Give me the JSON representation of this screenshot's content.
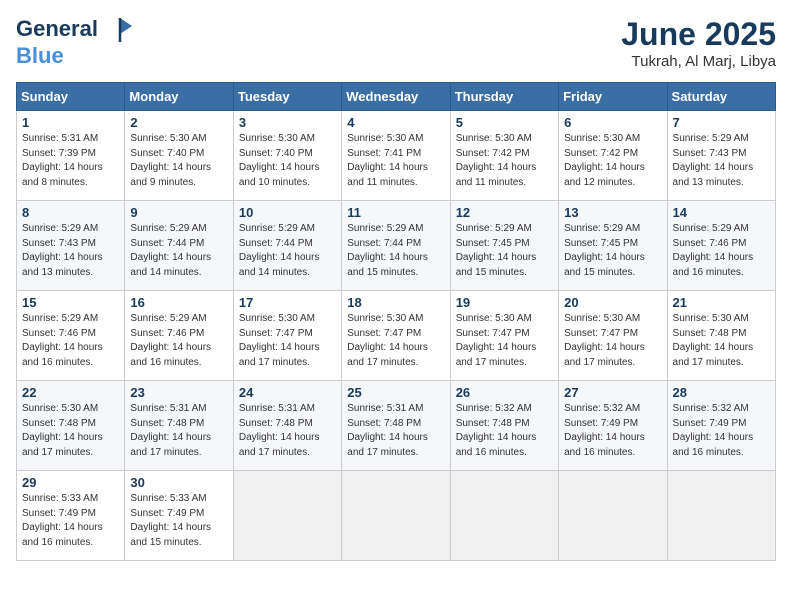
{
  "header": {
    "logo_line1": "General",
    "logo_line2": "Blue",
    "month_title": "June 2025",
    "location": "Tukrah, Al Marj, Libya"
  },
  "days_of_week": [
    "Sunday",
    "Monday",
    "Tuesday",
    "Wednesday",
    "Thursday",
    "Friday",
    "Saturday"
  ],
  "weeks": [
    [
      {
        "day": "1",
        "sunrise": "5:31 AM",
        "sunset": "7:39 PM",
        "daylight": "14 hours and 8 minutes."
      },
      {
        "day": "2",
        "sunrise": "5:30 AM",
        "sunset": "7:40 PM",
        "daylight": "14 hours and 9 minutes."
      },
      {
        "day": "3",
        "sunrise": "5:30 AM",
        "sunset": "7:40 PM",
        "daylight": "14 hours and 10 minutes."
      },
      {
        "day": "4",
        "sunrise": "5:30 AM",
        "sunset": "7:41 PM",
        "daylight": "14 hours and 11 minutes."
      },
      {
        "day": "5",
        "sunrise": "5:30 AM",
        "sunset": "7:42 PM",
        "daylight": "14 hours and 11 minutes."
      },
      {
        "day": "6",
        "sunrise": "5:30 AM",
        "sunset": "7:42 PM",
        "daylight": "14 hours and 12 minutes."
      },
      {
        "day": "7",
        "sunrise": "5:29 AM",
        "sunset": "7:43 PM",
        "daylight": "14 hours and 13 minutes."
      }
    ],
    [
      {
        "day": "8",
        "sunrise": "5:29 AM",
        "sunset": "7:43 PM",
        "daylight": "14 hours and 13 minutes."
      },
      {
        "day": "9",
        "sunrise": "5:29 AM",
        "sunset": "7:44 PM",
        "daylight": "14 hours and 14 minutes."
      },
      {
        "day": "10",
        "sunrise": "5:29 AM",
        "sunset": "7:44 PM",
        "daylight": "14 hours and 14 minutes."
      },
      {
        "day": "11",
        "sunrise": "5:29 AM",
        "sunset": "7:44 PM",
        "daylight": "14 hours and 15 minutes."
      },
      {
        "day": "12",
        "sunrise": "5:29 AM",
        "sunset": "7:45 PM",
        "daylight": "14 hours and 15 minutes."
      },
      {
        "day": "13",
        "sunrise": "5:29 AM",
        "sunset": "7:45 PM",
        "daylight": "14 hours and 15 minutes."
      },
      {
        "day": "14",
        "sunrise": "5:29 AM",
        "sunset": "7:46 PM",
        "daylight": "14 hours and 16 minutes."
      }
    ],
    [
      {
        "day": "15",
        "sunrise": "5:29 AM",
        "sunset": "7:46 PM",
        "daylight": "14 hours and 16 minutes."
      },
      {
        "day": "16",
        "sunrise": "5:29 AM",
        "sunset": "7:46 PM",
        "daylight": "14 hours and 16 minutes."
      },
      {
        "day": "17",
        "sunrise": "5:30 AM",
        "sunset": "7:47 PM",
        "daylight": "14 hours and 17 minutes."
      },
      {
        "day": "18",
        "sunrise": "5:30 AM",
        "sunset": "7:47 PM",
        "daylight": "14 hours and 17 minutes."
      },
      {
        "day": "19",
        "sunrise": "5:30 AM",
        "sunset": "7:47 PM",
        "daylight": "14 hours and 17 minutes."
      },
      {
        "day": "20",
        "sunrise": "5:30 AM",
        "sunset": "7:47 PM",
        "daylight": "14 hours and 17 minutes."
      },
      {
        "day": "21",
        "sunrise": "5:30 AM",
        "sunset": "7:48 PM",
        "daylight": "14 hours and 17 minutes."
      }
    ],
    [
      {
        "day": "22",
        "sunrise": "5:30 AM",
        "sunset": "7:48 PM",
        "daylight": "14 hours and 17 minutes."
      },
      {
        "day": "23",
        "sunrise": "5:31 AM",
        "sunset": "7:48 PM",
        "daylight": "14 hours and 17 minutes."
      },
      {
        "day": "24",
        "sunrise": "5:31 AM",
        "sunset": "7:48 PM",
        "daylight": "14 hours and 17 minutes."
      },
      {
        "day": "25",
        "sunrise": "5:31 AM",
        "sunset": "7:48 PM",
        "daylight": "14 hours and 17 minutes."
      },
      {
        "day": "26",
        "sunrise": "5:32 AM",
        "sunset": "7:48 PM",
        "daylight": "14 hours and 16 minutes."
      },
      {
        "day": "27",
        "sunrise": "5:32 AM",
        "sunset": "7:49 PM",
        "daylight": "14 hours and 16 minutes."
      },
      {
        "day": "28",
        "sunrise": "5:32 AM",
        "sunset": "7:49 PM",
        "daylight": "14 hours and 16 minutes."
      }
    ],
    [
      {
        "day": "29",
        "sunrise": "5:33 AM",
        "sunset": "7:49 PM",
        "daylight": "14 hours and 16 minutes."
      },
      {
        "day": "30",
        "sunrise": "5:33 AM",
        "sunset": "7:49 PM",
        "daylight": "14 hours and 15 minutes."
      },
      null,
      null,
      null,
      null,
      null
    ]
  ]
}
